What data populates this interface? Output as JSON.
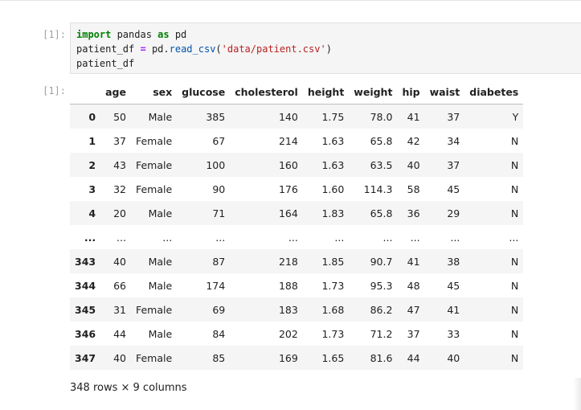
{
  "cell": {
    "in_prompt": "[1]:",
    "out_prompt": "[1]:",
    "code_lines": [
      [
        {
          "t": "import",
          "c": "kw"
        },
        {
          "t": " pandas ",
          "c": ""
        },
        {
          "t": "as",
          "c": "kw"
        },
        {
          "t": " pd",
          "c": ""
        }
      ],
      [
        {
          "t": "patient_df ",
          "c": ""
        },
        {
          "t": "=",
          "c": "op"
        },
        {
          "t": " pd.",
          "c": ""
        },
        {
          "t": "read_csv",
          "c": "fn"
        },
        {
          "t": "(",
          "c": ""
        },
        {
          "t": "'data/patient.csv'",
          "c": "str"
        },
        {
          "t": ")",
          "c": ""
        }
      ],
      [
        {
          "t": "patient_df",
          "c": ""
        }
      ]
    ]
  },
  "dataframe": {
    "columns": [
      "age",
      "sex",
      "glucose",
      "cholesterol",
      "height",
      "weight",
      "hip",
      "waist",
      "diabetes"
    ],
    "rows": [
      {
        "index": "0",
        "values": [
          "50",
          "Male",
          "385",
          "140",
          "1.75",
          "78.0",
          "41",
          "37",
          "Y"
        ]
      },
      {
        "index": "1",
        "values": [
          "37",
          "Female",
          "67",
          "214",
          "1.63",
          "65.8",
          "42",
          "34",
          "N"
        ]
      },
      {
        "index": "2",
        "values": [
          "43",
          "Female",
          "100",
          "160",
          "1.63",
          "63.5",
          "40",
          "37",
          "N"
        ]
      },
      {
        "index": "3",
        "values": [
          "32",
          "Female",
          "90",
          "176",
          "1.60",
          "114.3",
          "58",
          "45",
          "N"
        ]
      },
      {
        "index": "4",
        "values": [
          "20",
          "Male",
          "71",
          "164",
          "1.83",
          "65.8",
          "36",
          "29",
          "N"
        ]
      },
      {
        "index": "...",
        "values": [
          "...",
          "...",
          "...",
          "...",
          "...",
          "...",
          "...",
          "...",
          "..."
        ]
      },
      {
        "index": "343",
        "values": [
          "40",
          "Male",
          "87",
          "218",
          "1.85",
          "90.7",
          "41",
          "38",
          "N"
        ]
      },
      {
        "index": "344",
        "values": [
          "66",
          "Male",
          "174",
          "188",
          "1.73",
          "95.3",
          "48",
          "45",
          "N"
        ]
      },
      {
        "index": "345",
        "values": [
          "31",
          "Female",
          "69",
          "183",
          "1.68",
          "86.2",
          "47",
          "41",
          "N"
        ]
      },
      {
        "index": "346",
        "values": [
          "44",
          "Male",
          "84",
          "202",
          "1.73",
          "71.2",
          "37",
          "33",
          "N"
        ]
      },
      {
        "index": "347",
        "values": [
          "40",
          "Female",
          "85",
          "169",
          "1.65",
          "81.6",
          "44",
          "40",
          "N"
        ]
      }
    ],
    "shape_text": "348 rows × 9 columns"
  }
}
